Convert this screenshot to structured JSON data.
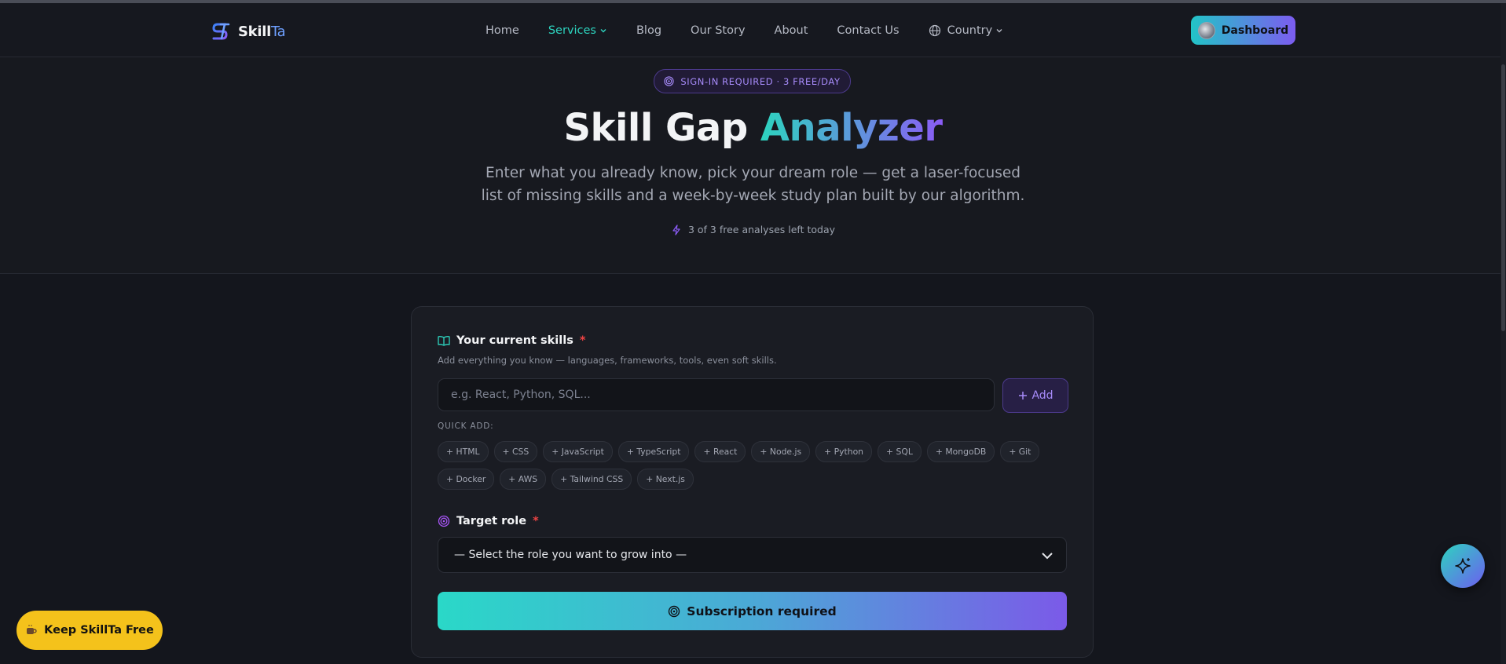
{
  "nav": {
    "logo_primary": "Skill",
    "logo_accent": "Ta",
    "links": {
      "home": "Home",
      "services": "Services",
      "blog": "Blog",
      "our_story": "Our Story",
      "about": "About",
      "contact": "Contact Us",
      "country": "Country"
    },
    "dashboard": "Dashboard"
  },
  "hero": {
    "badge": "SIGN-IN REQUIRED · 3 FREE/DAY",
    "title_plain": "Skill Gap ",
    "title_accent": "Analyzer",
    "subtitle": "Enter what you already know, pick your dream role — get a laser-focused list of missing skills and a week-by-week study plan built by our algorithm.",
    "remaining": "3 of 3 free analyses left today"
  },
  "form": {
    "skills_label": "Your current skills",
    "required_mark": "*",
    "skills_help": "Add everything you know — languages, frameworks, tools, even soft skills.",
    "skills_placeholder": "e.g. React, Python, SQL...",
    "add_label": "Add",
    "quick_label": "QUICK ADD:",
    "chips": [
      "+ HTML",
      "+ CSS",
      "+ JavaScript",
      "+ TypeScript",
      "+ React",
      "+ Node.js",
      "+ Python",
      "+ SQL",
      "+ MongoDB",
      "+ Git",
      "+ Docker",
      "+ AWS",
      "+ Tailwind CSS",
      "+ Next.js"
    ],
    "role_label": "Target role",
    "role_placeholder": "— Select the role you want to grow into —",
    "submit_label": "Subscription required"
  },
  "floating": {
    "keep_free": "Keep SkillTa Free"
  },
  "colors": {
    "accent_teal": "#2dd4bf",
    "accent_purple": "#8b5cf6",
    "keep_yellow": "#f4c21b",
    "required_red": "#ef4444"
  },
  "icons": [
    "logo-icon",
    "chevron-down-icon",
    "globe-icon",
    "avatar",
    "target-icon",
    "lightning-icon",
    "book-icon",
    "plus-icon",
    "sparkle-icon",
    "coffee-icon"
  ]
}
